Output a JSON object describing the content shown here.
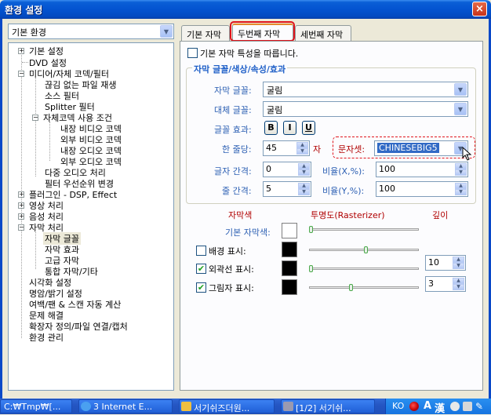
{
  "window": {
    "title": "환경 설정",
    "close_glyph": "×"
  },
  "left": {
    "category_select": "기본 환경",
    "tree": [
      {
        "label": "기본 설정"
      },
      {
        "label": "DVD 설정"
      },
      {
        "label": "미디어/자체 코덱/필터"
      },
      {
        "label": "끊김 없는 파일 재생"
      },
      {
        "label": "소스 필터"
      },
      {
        "label": "Splitter 필터"
      },
      {
        "label": "자체코덱 사용 조건"
      },
      {
        "label": "내장 비디오 코덱"
      },
      {
        "label": "외부 비디오 코덱"
      },
      {
        "label": "내장 오디오 코덱"
      },
      {
        "label": "외부 오디오 코덱"
      },
      {
        "label": "다중 오디오 처리"
      },
      {
        "label": "필터 우선순위 변경"
      },
      {
        "label": "플러그인 - DSP, Effect"
      },
      {
        "label": "영상 처리"
      },
      {
        "label": "음성 처리"
      },
      {
        "label": "자막 처리"
      },
      {
        "label": "자막 글꼴"
      },
      {
        "label": "자막 효과"
      },
      {
        "label": "고급 자막"
      },
      {
        "label": "통합 자막/기타"
      },
      {
        "label": "시각화 설정"
      },
      {
        "label": "명암/밝기 설정"
      },
      {
        "label": "여백/팬 & 스캔 자동 계산"
      },
      {
        "label": "문제 해결"
      },
      {
        "label": "확장자 정의/파일 연결/캡처"
      },
      {
        "label": "환경 관리"
      }
    ]
  },
  "tabs": [
    "기본 자막",
    "두번째 자막",
    "세번째 자막"
  ],
  "panel": {
    "follow_basic_label": "기본 자막 특성을 따릅니다.",
    "group_title": "자막 글꼴/색상/속성/효과",
    "font_label": "자막 글꼴:",
    "font_value": "굴림",
    "alt_font_label": "대체 글꼴:",
    "alt_font_value": "굴림",
    "effect_label": "글꼴 효과:",
    "bold": "B",
    "italic": "I",
    "underline": "U",
    "per_line_label": "한 줄당:",
    "per_line_value": "45",
    "per_line_unit": "자",
    "charset_label": "문자셋:",
    "charset_value": "CHINESEBIG5",
    "char_spacing_label": "글자 간격:",
    "char_spacing_value": "0",
    "ratio_x_label": "비율(X,%):",
    "ratio_x_value": "100",
    "line_spacing_label": "줄 간격:",
    "line_spacing_value": "5",
    "ratio_y_label": "비율(Y,%):",
    "ratio_y_value": "100",
    "col_color": "자막색",
    "col_transparency": "투명도(Rasterizer)",
    "col_depth": "깊이",
    "basic_color_label": "기본 자막색:",
    "bg_label": "배경 표시:",
    "outline_label": "외곽선 표시:",
    "outline_depth": "10",
    "shadow_label": "그림자 표시:",
    "shadow_depth": "3",
    "slider_basic_level": 0.0,
    "slider_bg_level": 0.52,
    "slider_outline_level": 0.0,
    "slider_shadow_level": 0.38,
    "follow_basic_checked": false,
    "bg_checked": false,
    "outline_checked": true,
    "shadow_checked": true
  },
  "taskbar": {
    "items": [
      "C:₩Tmp₩[...",
      "3 Internet E...",
      "서기쉬즈더원...",
      "[1/2] 서기쉬..."
    ],
    "ime": "KO",
    "hanja": "漢",
    "colors": {
      "bar": "#2556c3",
      "accent": "#e0141c"
    }
  }
}
